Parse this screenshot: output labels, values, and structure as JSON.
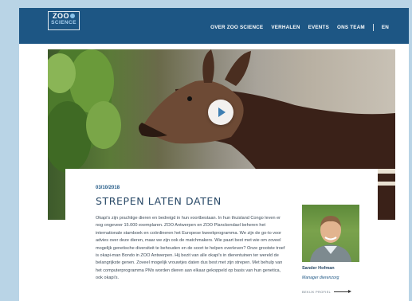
{
  "header": {
    "logo": {
      "line1": "ZOO",
      "line2": "SCIENCE"
    },
    "nav": [
      {
        "label": "OVER ZOO SCIENCE"
      },
      {
        "label": "VERHALEN"
      },
      {
        "label": "EVENTS"
      },
      {
        "label": "ONS TEAM"
      }
    ],
    "language": "EN"
  },
  "colors": {
    "brand": "#1d5684",
    "page_bg": "#b9d4e6",
    "accent": "#3f7fb2"
  },
  "hero": {
    "play_icon": "play-icon"
  },
  "article": {
    "date": "03/10/2018",
    "title": "STREPEN LATEN DATEN",
    "body": "Okapi's zijn prachtige dieren en bedreigd in hun voortbestaan. In hun thuisland Congo leven er nog ongeveer 15.000 exemplaren. ZOO Antwerpen en ZOO Planckendael beheren het internationale stamboek en coördineren het Europese kweekprogramma. We zijn de go-to voor advies over deze dieren, maar we zijn ook de matchmakers. Wie paart best met wie om zoveel mogelijk genetische diversiteit te behouden en de soort te helpen overleven? Onze grootste troef is okapi-man Bondo in ZOO Antwerpen. Hij bezit van alle okapi's in dierentuinen ter wereld de belangrijkste genen. Zoveel mogelijk vrouwtjes daten dus best met zijn strepen. Met behulp van het computerprogramma PMx worden dieren aan elkaar gekoppeld op basis van hun genetica, ook okapi's."
  },
  "author": {
    "name": "Sander Hofman",
    "role": "Manager dierenzorg",
    "profile_link": "BEKIJK PROFIEL",
    "link_icon": "arrow-right-icon"
  }
}
